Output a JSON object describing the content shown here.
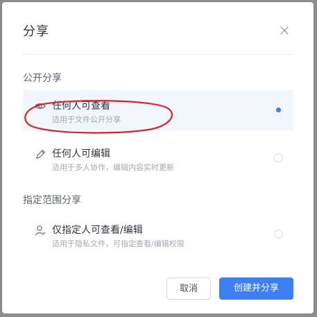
{
  "dialog": {
    "title": "分享"
  },
  "sections": {
    "public_label": "公开分享",
    "scoped_label": "指定范围分享"
  },
  "options": [
    {
      "name": "任何人可查看",
      "desc": "适用于文件公开分享",
      "icon": "eye-icon",
      "selected": true
    },
    {
      "name": "任何人可编辑",
      "desc": "适用于多人协作，编辑内容实时更新",
      "icon": "pencil-icon",
      "selected": false
    },
    {
      "name": "仅指定人可查看/编辑",
      "desc": "适用于隐私文件，可指定查看/编辑权限",
      "icon": "user-icon",
      "selected": false
    }
  ],
  "buttons": {
    "cancel": "取消",
    "create": "创建并分享"
  },
  "colors": {
    "accent": "#3d7ff3",
    "selected_bg": "#f1f5fc",
    "annotation": "#e02020"
  }
}
